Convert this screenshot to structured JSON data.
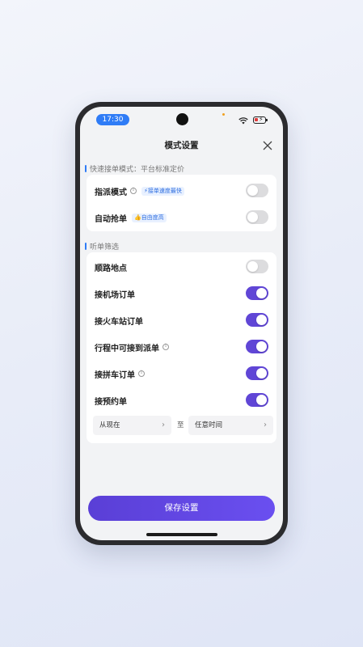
{
  "status_bar": {
    "time": "17:30"
  },
  "header": {
    "title": "模式设置"
  },
  "dispatch_section": {
    "title": "快速接单模式：平台标准定价",
    "rows": [
      {
        "label": "指派模式",
        "tag": "接单速度最快",
        "on": false
      },
      {
        "label": "自动抢单",
        "tag": "自由度高",
        "on": false
      }
    ]
  },
  "filter_section": {
    "title": "听单筛选",
    "rows": [
      {
        "label": "顺路地点",
        "on": false
      },
      {
        "label": "接机场订单",
        "on": true
      },
      {
        "label": "接火车站订单",
        "on": true
      },
      {
        "label": "行程中可接到派单",
        "on": true
      },
      {
        "label": "接拼车订单",
        "on": true
      },
      {
        "label": "接预约单",
        "on": true
      }
    ],
    "time_range": {
      "from": "从现在",
      "separator": "至",
      "to": "任意时间"
    }
  },
  "footer": {
    "save_label": "保存设置"
  },
  "colors": {
    "accent": "#6046d6",
    "tag_blue": "#2f6fe0",
    "time_pill": "#2f7cf6"
  }
}
